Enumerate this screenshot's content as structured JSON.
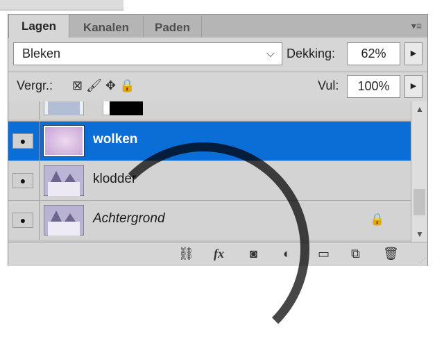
{
  "tabs": [
    "Lagen",
    "Kanalen",
    "Paden"
  ],
  "blend_mode": "Bleken",
  "opacity": {
    "label": "Dekking:",
    "value": "62%"
  },
  "fill": {
    "label": "Vul:",
    "value": "100%"
  },
  "lock_label": "Vergr.:",
  "layers": [
    {
      "name": "wolken",
      "selected": true,
      "locked": false
    },
    {
      "name": "klodder",
      "selected": false,
      "locked": false
    },
    {
      "name": "Achtergrond",
      "selected": false,
      "locked": true
    }
  ],
  "colors": {
    "selection": "#0a6ed6",
    "panel": "#d6d6d6"
  },
  "icons": [
    "link-icon",
    "fx-icon",
    "mask-icon",
    "adjustment-icon",
    "folder-icon",
    "new-layer-icon",
    "trash-icon"
  ]
}
